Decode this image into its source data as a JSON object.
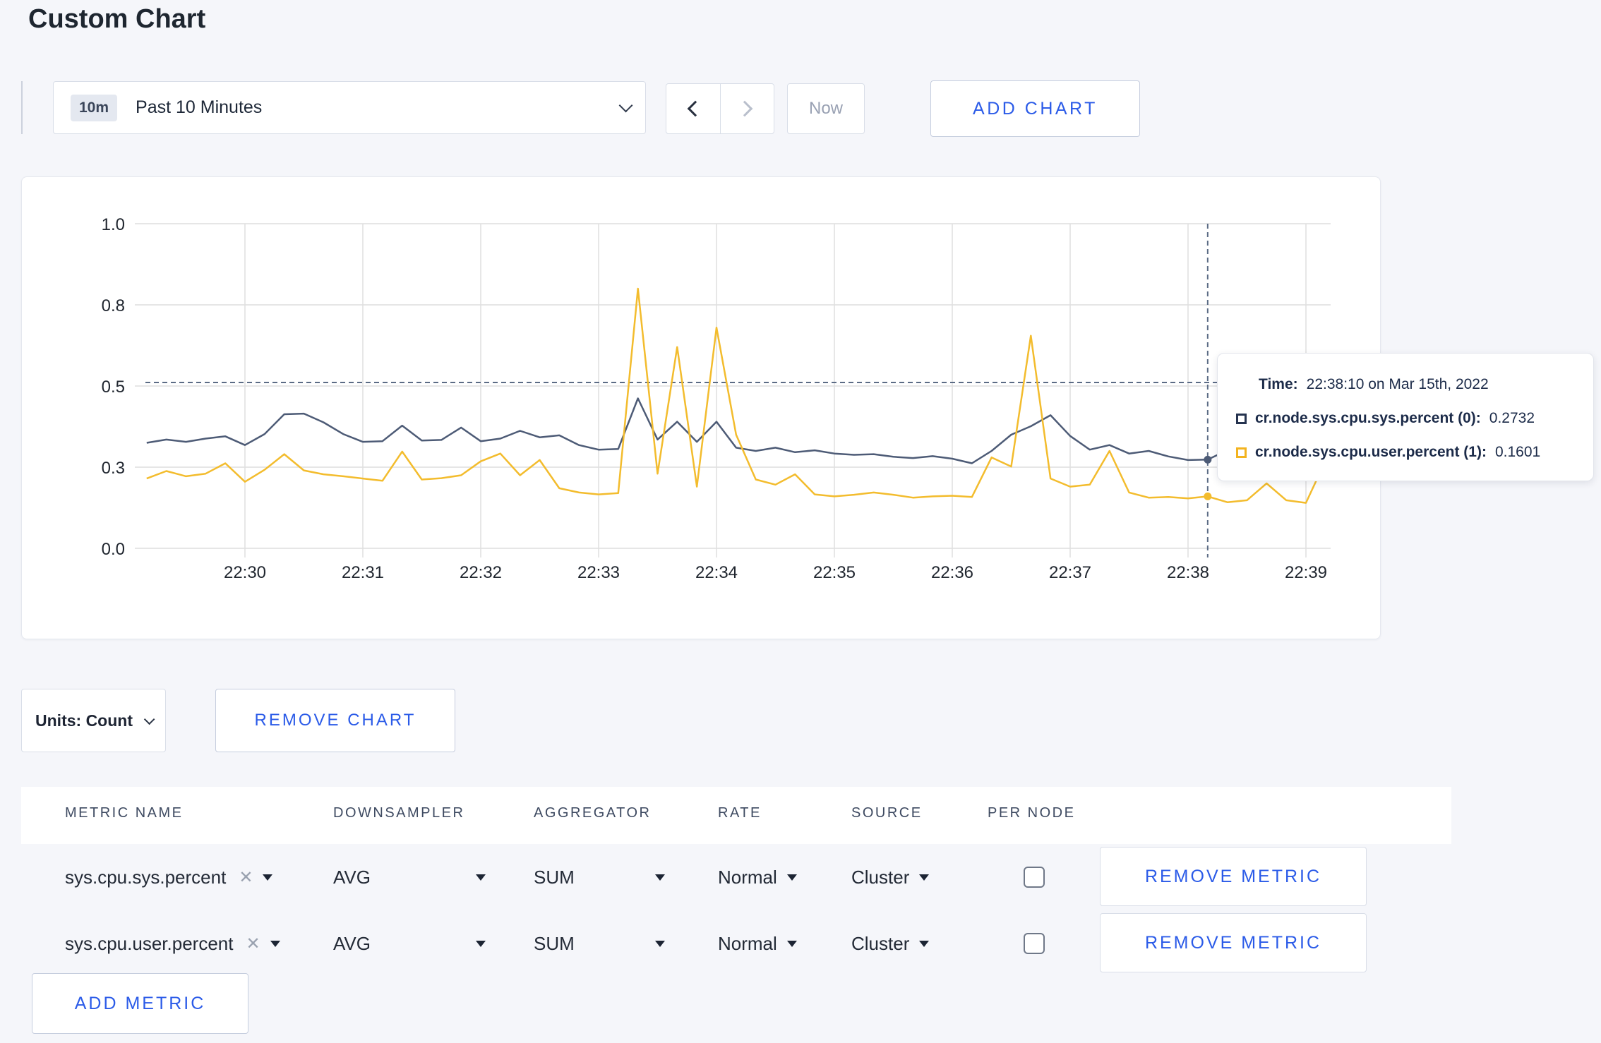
{
  "page": {
    "title": "Custom Chart",
    "background": "#f5f6fa"
  },
  "toolbar": {
    "range_badge": "10m",
    "range_label": "Past 10 Minutes",
    "now_label": "Now",
    "add_chart_label": "ADD CHART"
  },
  "chart_data": {
    "type": "line",
    "title": "",
    "xlabel": "",
    "ylabel": "",
    "ylim": [
      0,
      1
    ],
    "grid": true,
    "x_ticks": [
      "22:30",
      "22:31",
      "22:32",
      "22:33",
      "22:34",
      "22:35",
      "22:36",
      "22:37",
      "22:38",
      "22:39"
    ],
    "y_ticks": [
      {
        "v": 0.0,
        "label": "0.0"
      },
      {
        "v": 0.25,
        "label": "0.3"
      },
      {
        "v": 0.5,
        "label": "0.5"
      },
      {
        "v": 0.75,
        "label": "0.8"
      },
      {
        "v": 1.0,
        "label": "1.0"
      }
    ],
    "start_time": "22:29:10",
    "interval_seconds": 10,
    "series": [
      {
        "name": "cr.node.sys.cpu.sys.percent (0)",
        "color": "#4d5b76",
        "values": [
          0.325,
          0.335,
          0.328,
          0.338,
          0.345,
          0.318,
          0.352,
          0.413,
          0.415,
          0.388,
          0.352,
          0.328,
          0.33,
          0.378,
          0.332,
          0.334,
          0.372,
          0.33,
          0.338,
          0.362,
          0.342,
          0.348,
          0.318,
          0.304,
          0.306,
          0.462,
          0.335,
          0.39,
          0.328,
          0.39,
          0.31,
          0.3,
          0.31,
          0.296,
          0.302,
          0.292,
          0.288,
          0.29,
          0.282,
          0.278,
          0.284,
          0.276,
          0.262,
          0.3,
          0.35,
          0.376,
          0.41,
          0.346,
          0.304,
          0.318,
          0.292,
          0.3,
          0.283,
          0.272,
          0.2732,
          0.302,
          0.29,
          0.296,
          0.286,
          0.292,
          0.3
        ]
      },
      {
        "name": "cr.node.sys.cpu.user.percent (1)",
        "color": "#f3bc2d",
        "values": [
          0.215,
          0.238,
          0.222,
          0.23,
          0.262,
          0.205,
          0.242,
          0.29,
          0.24,
          0.228,
          0.222,
          0.215,
          0.208,
          0.298,
          0.212,
          0.216,
          0.225,
          0.268,
          0.292,
          0.225,
          0.272,
          0.185,
          0.172,
          0.166,
          0.17,
          0.8,
          0.23,
          0.62,
          0.19,
          0.68,
          0.35,
          0.212,
          0.196,
          0.228,
          0.166,
          0.16,
          0.165,
          0.172,
          0.165,
          0.156,
          0.16,
          0.162,
          0.158,
          0.28,
          0.252,
          0.655,
          0.215,
          0.19,
          0.196,
          0.3,
          0.172,
          0.156,
          0.158,
          0.154,
          0.1601,
          0.142,
          0.148,
          0.2,
          0.148,
          0.14,
          0.27
        ]
      }
    ],
    "crosshair": {
      "time": "22:38:10",
      "line_y": 0.511,
      "points": [
        0.2732,
        0.1601
      ]
    },
    "legend_position": "tooltip"
  },
  "tooltip": {
    "time_label": "Time:",
    "time_value": "22:38:10 on Mar 15th, 2022",
    "rows": [
      {
        "label": "cr.node.sys.cpu.sys.percent (0):",
        "value": "0.2732",
        "color": "#25334f"
      },
      {
        "label": "cr.node.sys.cpu.user.percent (1):",
        "value": "0.1601",
        "color": "#f3b31f"
      }
    ]
  },
  "chart_footer": {
    "units_label": "Units: Count",
    "remove_chart_label": "REMOVE CHART"
  },
  "metrics_table": {
    "headers": [
      "METRIC NAME",
      "DOWNSAMPLER",
      "AGGREGATOR",
      "RATE",
      "SOURCE",
      "PER NODE"
    ],
    "rows": [
      {
        "metric": "sys.cpu.sys.percent",
        "downsampler": "AVG",
        "aggregator": "SUM",
        "rate": "Normal",
        "source": "Cluster",
        "per_node": false,
        "remove_label": "REMOVE METRIC"
      },
      {
        "metric": "sys.cpu.user.percent",
        "downsampler": "AVG",
        "aggregator": "SUM",
        "rate": "Normal",
        "source": "Cluster",
        "per_node": false,
        "remove_label": "REMOVE METRIC"
      }
    ],
    "add_metric_label": "ADD METRIC"
  }
}
